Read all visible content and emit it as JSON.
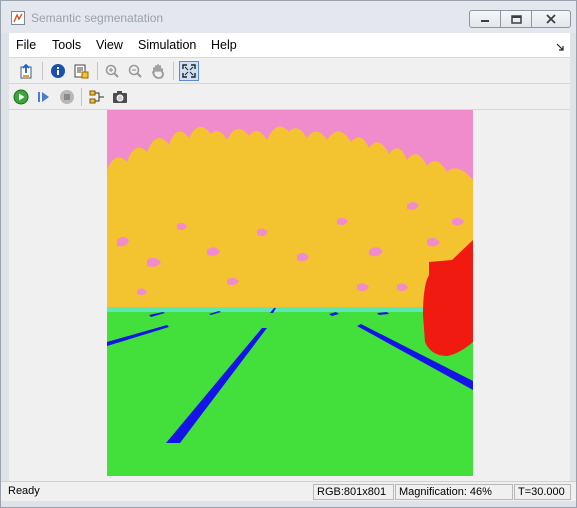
{
  "window": {
    "title": "Semantic segmenatation"
  },
  "menu": {
    "items": [
      "File",
      "Tools",
      "View",
      "Simulation",
      "Help"
    ]
  },
  "toolbar1": {
    "icons": [
      "export-icon",
      "info-icon",
      "properties-icon",
      "zoom-in-icon",
      "zoom-out-icon",
      "pan-icon",
      "fit-to-view-icon"
    ]
  },
  "toolbar2": {
    "icons": [
      "run-icon",
      "step-forward-icon",
      "stop-icon",
      "signal-select-icon",
      "snapshot-icon"
    ]
  },
  "image": {
    "content": "semantic segmentation label map",
    "colors": {
      "sky": "#f08ccb",
      "vegetation": "#f4c430",
      "road": "#43e03c",
      "lane_marking": "#1414e8",
      "horizon_strip": "#5ce8b4",
      "vehicle": "#f01a10"
    }
  },
  "status": {
    "state": "Ready",
    "size": "RGB:801x801",
    "magnification": "Magnification: 46%",
    "time": "T=30.000"
  }
}
